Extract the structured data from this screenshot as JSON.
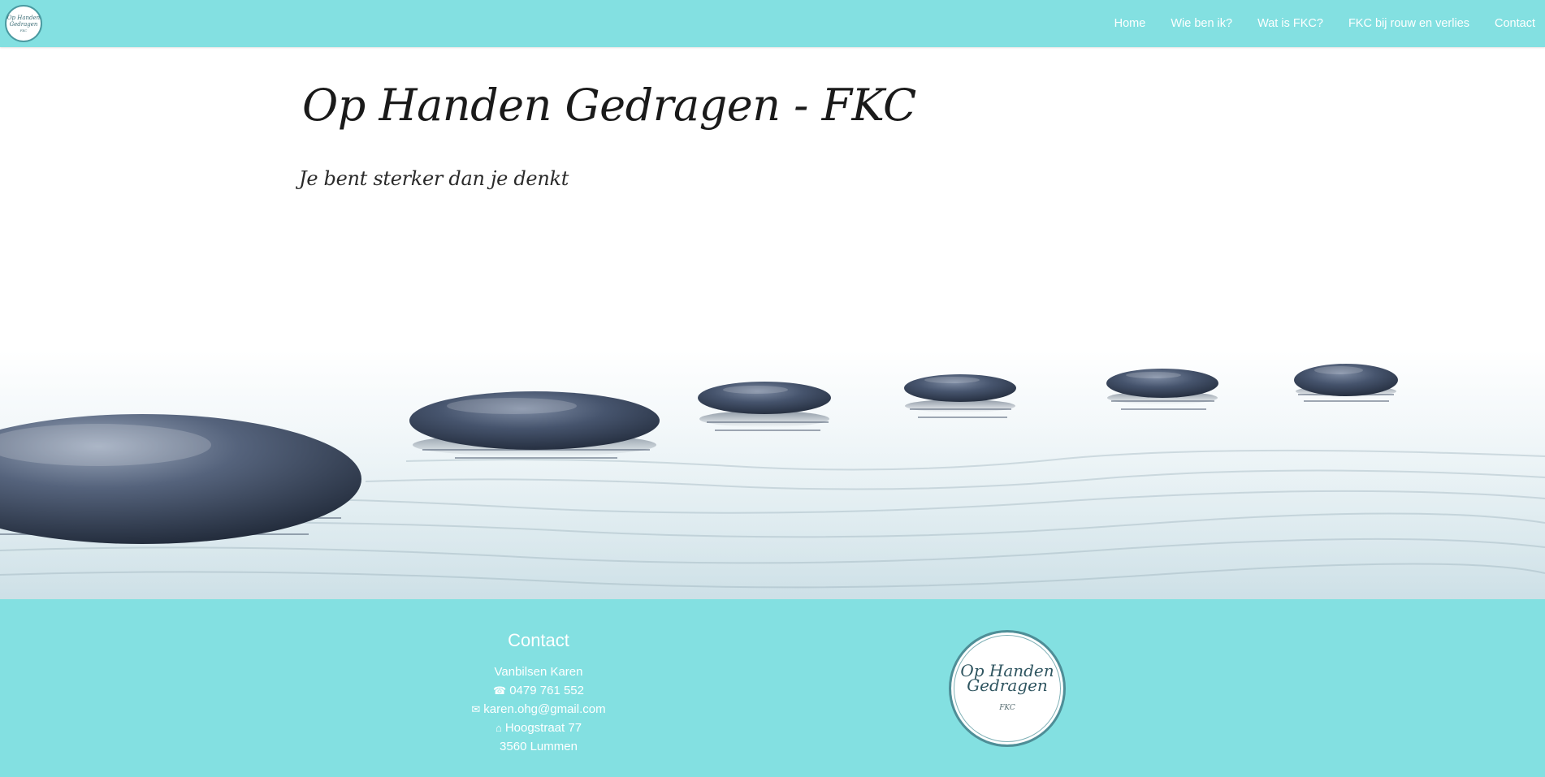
{
  "header": {
    "logo_lines": [
      "Op Handen",
      "Gedragen",
      "FKC"
    ],
    "nav": [
      {
        "label": "Home"
      },
      {
        "label": "Wie ben ik?"
      },
      {
        "label": "Wat is FKC?"
      },
      {
        "label": "FKC bij rouw en verlies"
      },
      {
        "label": "Contact"
      }
    ]
  },
  "hero": {
    "title": "Op Handen Gedragen - FKC",
    "subtitle": "Je bent sterker dan je denkt",
    "image_subject": "zen stepping stones on water"
  },
  "footer": {
    "contact_heading": "Contact",
    "name": "Vanbilsen Karen",
    "phone_icon": "☎",
    "phone": "0479 761 552",
    "email_icon": "✉",
    "email": "karen.ohg@gmail.com",
    "address_icon": "⌂",
    "street": "Hoogstraat 77",
    "city": "3560 Lummen",
    "logo_lines": [
      "Op Handen",
      "Gedragen",
      "FKC"
    ]
  },
  "colors": {
    "accent": "#83e0e1",
    "text_on_accent": "#ffffff",
    "stone": "#3c4a60"
  }
}
